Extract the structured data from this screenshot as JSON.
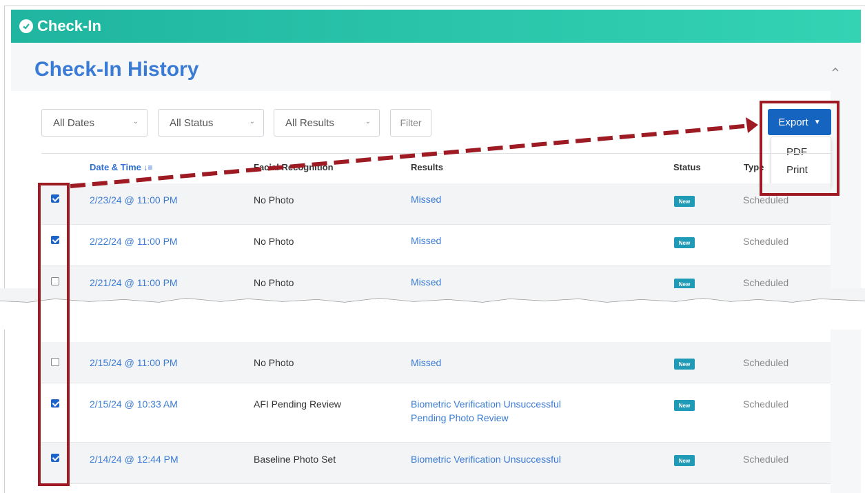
{
  "header": {
    "title": "Check-In"
  },
  "panel": {
    "title": "Check-In History"
  },
  "filters": {
    "dates": "All Dates",
    "status": "All Status",
    "results": "All Results",
    "filter_button": "Filter"
  },
  "export": {
    "button_label": "Export",
    "menu": [
      "PDF",
      "Print"
    ]
  },
  "table": {
    "columns": {
      "date": "Date & Time",
      "facial": "Facial Recognition",
      "results": "Results",
      "status": "Status",
      "type": "Type"
    },
    "rows": [
      {
        "checked": true,
        "date": "2/23/24 @ 11:00 PM",
        "facial": "No Photo",
        "results": [
          "Missed"
        ],
        "status": "New",
        "type": "Scheduled"
      },
      {
        "checked": true,
        "date": "2/22/24 @ 11:00 PM",
        "facial": "No Photo",
        "results": [
          "Missed"
        ],
        "status": "New",
        "type": "Scheduled"
      },
      {
        "checked": false,
        "date": "2/21/24 @ 11:00 PM",
        "facial": "No Photo",
        "results": [
          "Missed"
        ],
        "status": "New",
        "type": "Scheduled"
      },
      {
        "checked": false,
        "date": "2/15/24 @ 11:00 PM",
        "facial": "No Photo",
        "results": [
          "Missed"
        ],
        "status": "New",
        "type": "Scheduled"
      },
      {
        "checked": true,
        "date": "2/15/24 @ 10:33 AM",
        "facial": "AFI Pending Review",
        "results": [
          "Biometric Verification Unsuccessful",
          "Pending Photo Review"
        ],
        "status": "New",
        "type": "Scheduled"
      },
      {
        "checked": true,
        "date": "2/14/24 @ 12:44 PM",
        "facial": "Baseline Photo Set",
        "results": [
          "Biometric Verification Unsuccessful"
        ],
        "status": "New",
        "type": "Scheduled"
      }
    ]
  },
  "colors": {
    "header_start": "#1fb5a0",
    "header_end": "#34d3b4",
    "accent": "#3a7bd5",
    "export": "#1565c0",
    "highlight": "#9e1b24",
    "badge": "#1f9bb8"
  }
}
